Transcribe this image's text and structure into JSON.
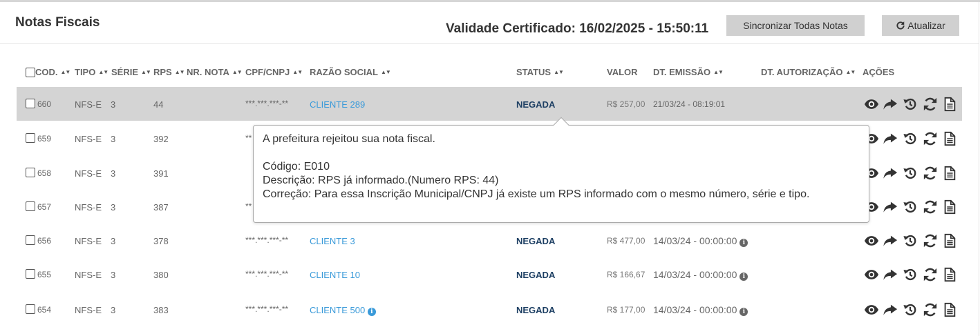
{
  "header": {
    "title": "Notas Fiscais",
    "certificate_validity": "Validade Certificado: 16/02/2025 - 15:50:11",
    "sync_button": "Sincronizar Todas Notas",
    "update_button": "Atualizar"
  },
  "columns": {
    "codigo": "COD.",
    "tipo": "TIPO",
    "serie": "SÉRIE",
    "rps": "RPS",
    "nr_nota": "NR. NOTA",
    "cpf_cnpj": "CPF/CNPJ",
    "razao_social": "RAZÃO SOCIAL",
    "status": "STATUS",
    "valor": "VALOR",
    "dt_emissao": "DT. EMISSÃO",
    "dt_autorizacao": "DT. AUTORIZAÇÃO",
    "acoes": "AÇÕES"
  },
  "rows": [
    {
      "code": "660",
      "tipo": "NFS-E",
      "serie": "3",
      "rps": "44",
      "cpf": "***.***.***-**",
      "razao": "CLIENTE 289",
      "status": "NEGADA",
      "valor": "R$ 257,00",
      "dt_emissao": "21/03/24 - 08:19:01"
    },
    {
      "code": "659",
      "tipo": "NFS-E",
      "serie": "3",
      "rps": "392",
      "cpf": "**"
    },
    {
      "code": "658",
      "tipo": "NFS-E",
      "serie": "3",
      "rps": "391"
    },
    {
      "code": "657",
      "tipo": "NFS-E",
      "serie": "3",
      "rps": "387",
      "cpf": "**"
    },
    {
      "code": "656",
      "tipo": "NFS-E",
      "serie": "3",
      "rps": "378",
      "cpf": "***.***.***-**",
      "razao": "CLIENTE 3",
      "status": "NEGADA",
      "valor": "R$ 477,00",
      "dt_emissao": "14/03/24 - 00:00:00"
    },
    {
      "code": "655",
      "tipo": "NFS-E",
      "serie": "3",
      "rps": "380",
      "cpf": "***.***.***-**",
      "razao": "CLIENTE 10",
      "status": "NEGADA",
      "valor": "R$ 166,67",
      "dt_emissao": "14/03/24 - 00:00:00"
    },
    {
      "code": "654",
      "tipo": "NFS-E",
      "serie": "3",
      "rps": "383",
      "cpf": "***.***.***-**",
      "razao": "CLIENTE 500",
      "status": "NEGADA",
      "valor": "R$ 177,00",
      "dt_emissao": "14/03/24 - 00:00:00"
    }
  ],
  "row_actions": [
    "eye-icon",
    "share-icon",
    "history-icon",
    "refresh-icon",
    "document-icon"
  ],
  "tooltip": {
    "line1": "A prefeitura rejeitou sua nota fiscal.",
    "line2": "Código: E010",
    "line3": "Descrição: RPS já informado.(Numero RPS: 44)",
    "line4": "Correção: Para essa Inscrição Municipal/CNPJ já existe um RPS informado com o mesmo número, série e tipo."
  },
  "colors": {
    "link": "#3a9ad9",
    "status": "#1d3f63",
    "selected_row": "#d4d4d4",
    "button": "#d0d0d0"
  }
}
